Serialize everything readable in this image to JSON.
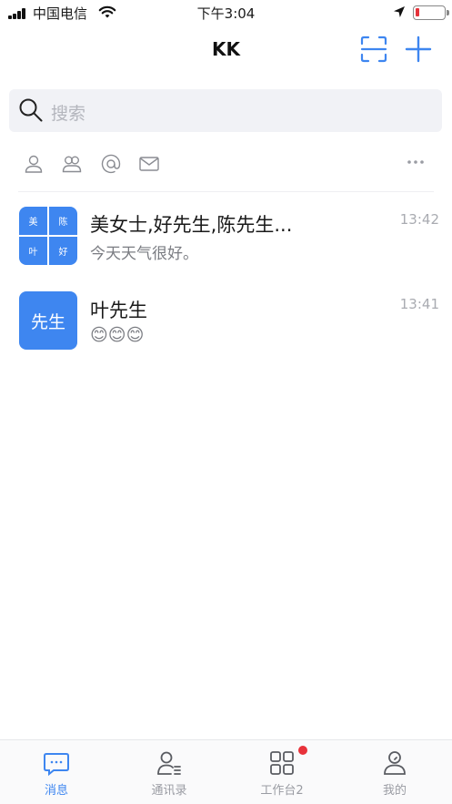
{
  "status_bar": {
    "carrier": "中国电信",
    "time": "下午3:04"
  },
  "header": {
    "title": "KK",
    "scan_icon": "scan-icon",
    "add_icon": "plus-icon"
  },
  "search": {
    "placeholder": "搜索"
  },
  "filters": [
    {
      "icon": "person-icon"
    },
    {
      "icon": "group-icon"
    },
    {
      "icon": "at-icon"
    },
    {
      "icon": "mail-icon"
    }
  ],
  "conversations": [
    {
      "name": "美女士,好先生,陈先生...",
      "preview": "今天天气很好。",
      "time": "13:42",
      "avatar_chars": [
        "美",
        "陈",
        "叶",
        "好"
      ]
    },
    {
      "name": "叶先生",
      "preview": "😊😊😊",
      "time": "13:41",
      "avatar_text": "先生"
    }
  ],
  "tabs": [
    {
      "label": "消息",
      "icon": "message-icon",
      "active": true
    },
    {
      "label": "通讯录",
      "icon": "contacts-icon",
      "active": false
    },
    {
      "label": "工作台2",
      "icon": "workbench-icon",
      "active": false
    },
    {
      "label": "我的",
      "icon": "profile-icon",
      "active": false
    }
  ],
  "colors": {
    "accent": "#3e86f0",
    "badge": "#e8323a",
    "battery_low": "#e5323a"
  }
}
